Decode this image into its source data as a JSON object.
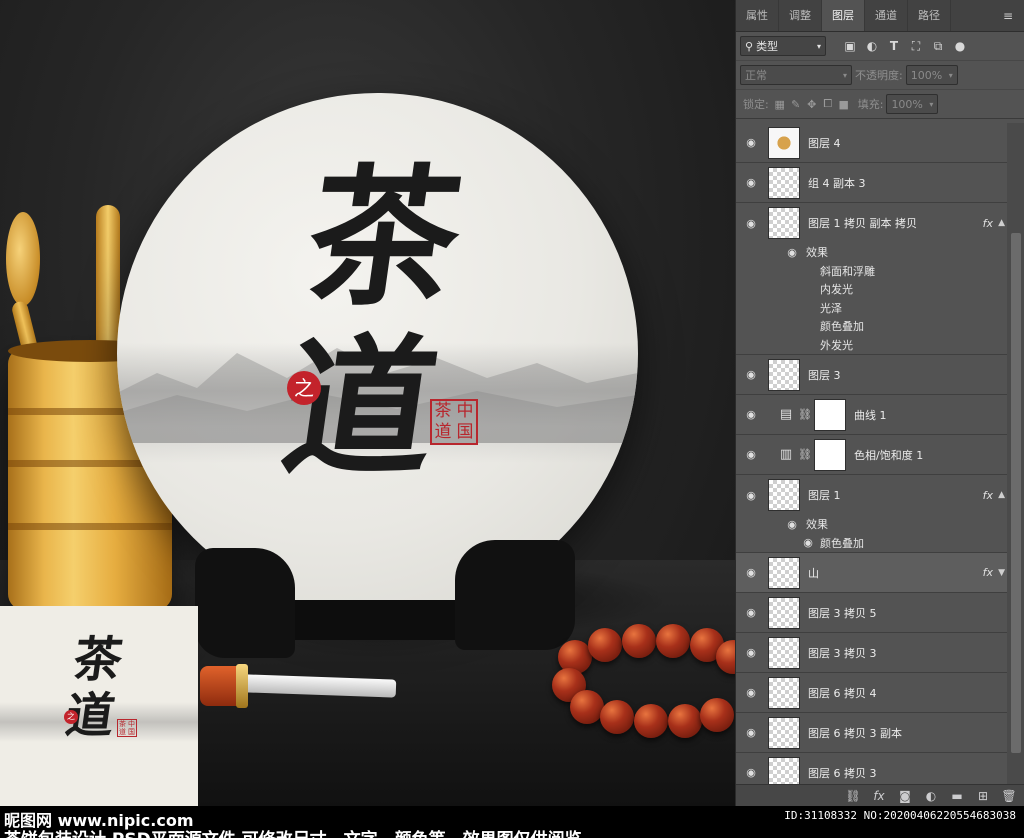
{
  "artwork": {
    "calligraphy": [
      "茶",
      "道"
    ],
    "small_char": "之",
    "seal": [
      "茶",
      "中",
      "道",
      "国"
    ]
  },
  "panel": {
    "tabs": [
      {
        "label": "属性",
        "active": false
      },
      {
        "label": "调整",
        "active": false
      },
      {
        "label": "图层",
        "active": true
      },
      {
        "label": "通道",
        "active": false
      },
      {
        "label": "路径",
        "active": false
      }
    ],
    "filter": {
      "kind_label": "类型",
      "icons": [
        "image-filter-icon",
        "adjustment-filter-icon",
        "type-filter-icon",
        "shape-filter-icon",
        "smart-object-filter-icon",
        "filter-toggle-icon"
      ]
    },
    "blend_mode": "正常",
    "opacity": {
      "label": "不透明度:",
      "value": "100%"
    },
    "lock": {
      "label": "锁定:",
      "icons": [
        "lock-transparent-icon",
        "lock-paint-icon",
        "lock-move-icon",
        "lock-artboard-icon",
        "lock-all-icon"
      ]
    },
    "fill": {
      "label": "填充:",
      "value": "100%"
    },
    "layers": [
      {
        "name": "图层 4",
        "type": "pixel",
        "fx": false
      },
      {
        "name": "组 4 副本 3",
        "type": "pixel",
        "fx": false
      },
      {
        "name": "图层 1 拷贝 副本 拷贝",
        "type": "pixel",
        "fx": true,
        "effects_label": "效果",
        "effects": [
          "斜面和浮雕",
          "内发光",
          "光泽",
          "颜色叠加",
          "外发光"
        ]
      },
      {
        "name": "图层 3",
        "type": "pixel",
        "fx": false
      },
      {
        "name": "曲线 1",
        "type": "curves",
        "fx": false
      },
      {
        "name": "色相/饱和度 1",
        "type": "hue",
        "fx": false
      },
      {
        "name": "图层 1",
        "type": "pixel",
        "fx": true,
        "effects_label": "效果",
        "effects": [
          "颜色叠加"
        ],
        "effects_with_eye": true
      },
      {
        "name": "山",
        "type": "pixel",
        "fx": true,
        "selected": true
      },
      {
        "name": "图层 3 拷贝 5",
        "type": "pixel",
        "fx": false
      },
      {
        "name": "图层 3 拷贝 3",
        "type": "pixel",
        "fx": false
      },
      {
        "name": "图层 6 拷贝 4",
        "type": "pixel",
        "fx": false
      },
      {
        "name": "图层 6 拷贝 3 副本",
        "type": "pixel",
        "fx": false
      },
      {
        "name": "图层 6 拷贝 3",
        "type": "pixel",
        "fx": false
      }
    ],
    "bottom_icons": [
      "link-layers-icon",
      "fx-icon",
      "mask-icon",
      "adjustment-layer-icon",
      "group-folder-icon",
      "new-layer-icon",
      "trash-icon"
    ]
  },
  "watermark": {
    "brand": "昵图网 www.nipic.com",
    "caption": "茶饼包装设计 PSD平面源文件 可修改尺寸、文字、颜色等，效果图仅供阅览",
    "id": "ID:31108332 NO:20200406220554683038"
  },
  "colors": {
    "panel_bg": "#535353",
    "tab_bg": "#424242",
    "seal_red": "#c3232b"
  }
}
